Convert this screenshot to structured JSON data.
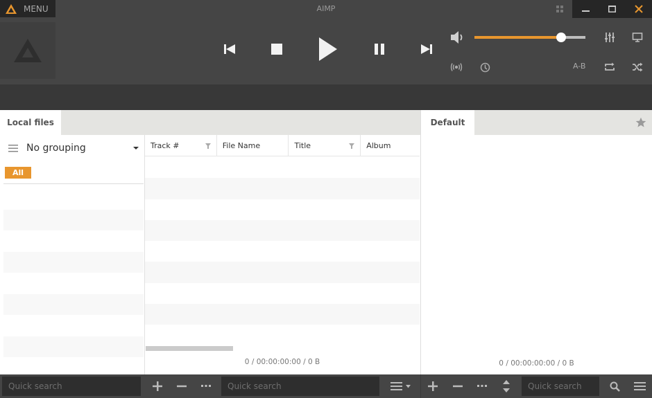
{
  "titlebar": {
    "menu_label": "MENU",
    "app_title": "AIMP",
    "icons": [
      "aimp-logo-icon",
      "mini-player-icon",
      "minimize-icon",
      "maximize-icon",
      "close-icon"
    ]
  },
  "player": {
    "controls": [
      "previous-icon",
      "stop-icon",
      "play-icon",
      "pause-icon",
      "next-icon"
    ],
    "volume_percent": 78,
    "ab_repeat_label": "A-B",
    "accent_color": "#e8962e"
  },
  "library": {
    "tab_label": "Local files",
    "grouping_label": "No grouping",
    "filter_chip": "All",
    "columns": [
      {
        "label": "Track #",
        "filter": true
      },
      {
        "label": "File Name",
        "filter": false
      },
      {
        "label": "Title",
        "filter": true
      },
      {
        "label": "Album",
        "filter": false
      }
    ],
    "stats": "0 / 00:00:00:00 / 0 B",
    "search_placeholder": "Quick search"
  },
  "playlist": {
    "tab_label": "Default",
    "stats": "0 / 00:00:00:00 / 0 B",
    "search_placeholder": "Quick search"
  },
  "bottombar": {
    "left_search_placeholder": "Quick search",
    "middle_search_placeholder": "Quick search",
    "right_search_placeholder": "Quick search"
  }
}
